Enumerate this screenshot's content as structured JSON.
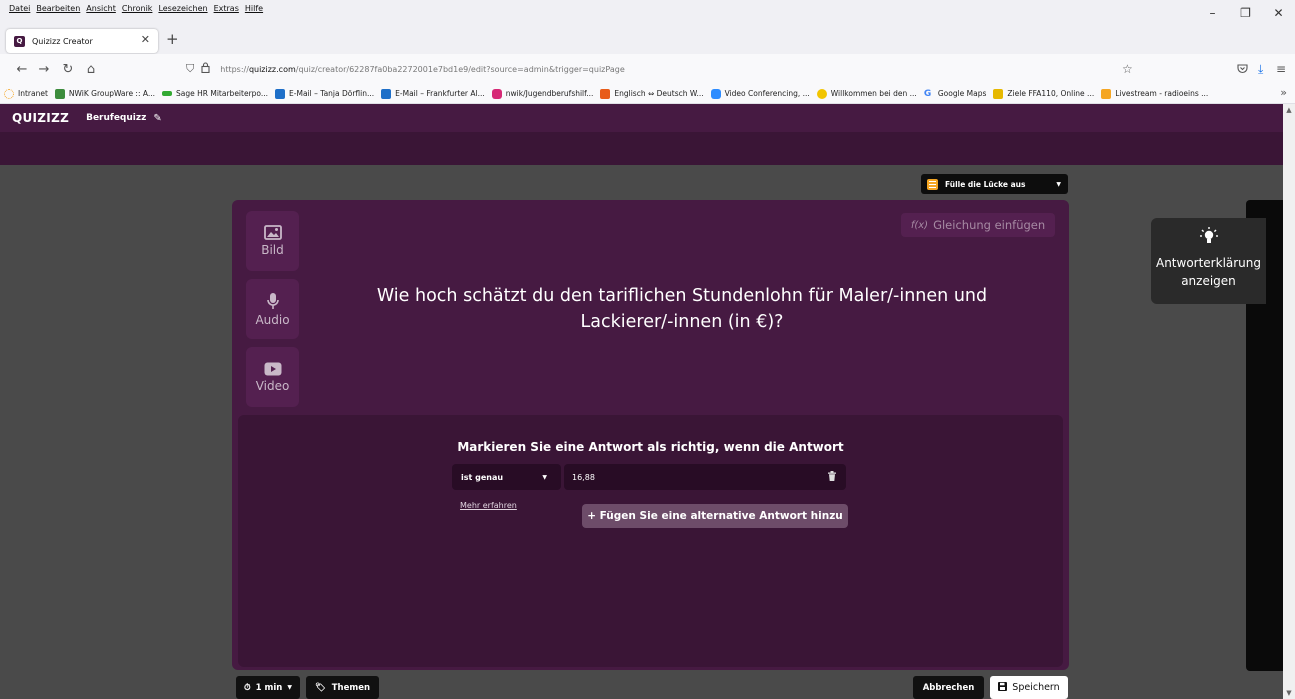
{
  "browser": {
    "menu": [
      "Datei",
      "Bearbeiten",
      "Ansicht",
      "Chronik",
      "Lesezeichen",
      "Extras",
      "Hilfe"
    ],
    "window_controls": {
      "minimize": "–",
      "maximize": "❐",
      "close": "✕"
    },
    "tab": {
      "title": "Quizizz Creator",
      "close": "✕"
    },
    "new_tab": "+",
    "url_prefix": "https://",
    "url_domain": "quizizz.com",
    "url_path": "/quiz/creator/62287fa0ba2272001e7bd1e9/edit?source=admin&trigger=quizPage",
    "bookmarks": [
      {
        "label": "Intranet",
        "color": "#f5a623"
      },
      {
        "label": "NWiK GroupWare :: A...",
        "color": "#3c8c3c"
      },
      {
        "label": "Sage HR Mitarbeiterpo...",
        "color": "#33aa33"
      },
      {
        "label": "E-Mail – Tanja Dörflin...",
        "color": "#1e6fc8"
      },
      {
        "label": "E-Mail – Frankfurter Al...",
        "color": "#1e6fc8"
      },
      {
        "label": "nwik/Jugendberufshilf...",
        "color": "#d62976"
      },
      {
        "label": "Englisch ⇔ Deutsch W...",
        "color": "#e85c1a"
      },
      {
        "label": "Video Conferencing, ...",
        "color": "#2d8cff"
      },
      {
        "label": "Willkommen bei den ...",
        "color": "#f2c500"
      },
      {
        "label": "Google Maps",
        "color": "#4285f4"
      },
      {
        "label": "Ziele FFA110, Online ...",
        "color": "#e6b800"
      },
      {
        "label": "Livestream - radioeins ...",
        "color": "#f5a623"
      }
    ],
    "bookmarks_more": "»"
  },
  "app": {
    "logo": "QUIZIZZ",
    "quiz_title": "Berufequizz",
    "question_type": "Fülle die Lücke aus",
    "media": [
      {
        "label": "Bild",
        "icon": "image-icon"
      },
      {
        "label": "Audio",
        "icon": "microphone-icon"
      },
      {
        "label": "Video",
        "icon": "video-icon"
      }
    ],
    "equation_button": "Gleichung einfügen",
    "equation_icon_text": "f(x)",
    "question_text": "Wie hoch schätzt du den tariflichen Stundenlohn für Maler/-innen und Lackierer/-innen (in €)?",
    "answer": {
      "instruction": "Markieren Sie eine Antwort als richtig, wenn die Antwort",
      "condition": "ist genau",
      "value": "16,88",
      "learn_more": "Mehr erfahren",
      "add_alternative": "+ Fügen Sie eine alternative Antwort hinzu"
    },
    "explanation": "Antworterklärung anzeigen",
    "footer": {
      "timer": "1 min",
      "themes": "Themen",
      "cancel": "Abbrechen",
      "save": "Speichern"
    }
  }
}
